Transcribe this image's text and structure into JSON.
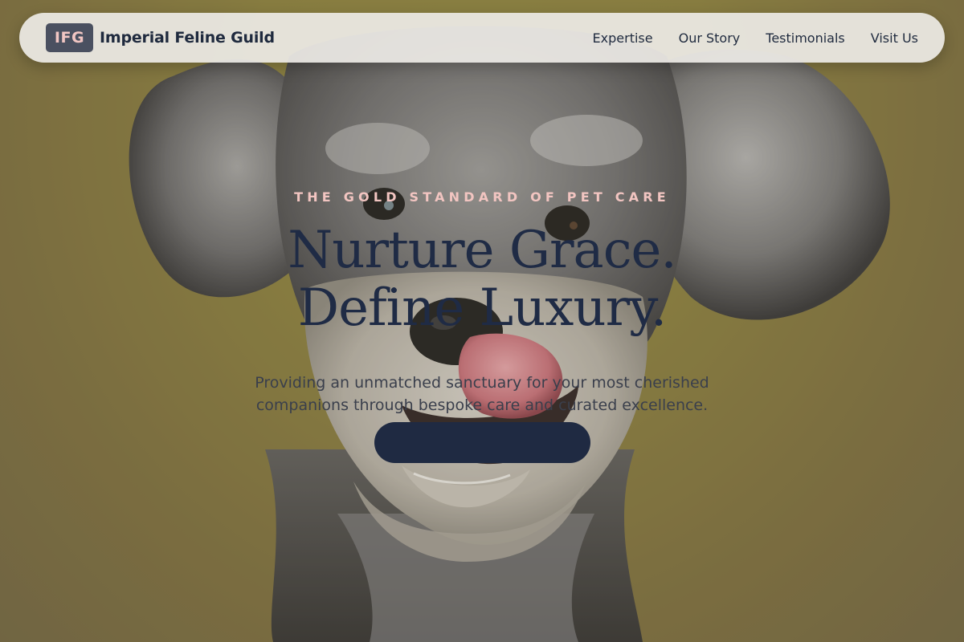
{
  "navbar": {
    "badge": "IFG",
    "brand_name": "Imperial Feline Guild",
    "links": [
      "Expertise",
      "Our Story",
      "Testimonials",
      "Visit Us"
    ]
  },
  "hero": {
    "eyebrow": "THE GOLD STANDARD OF PET CARE",
    "headline_line1": "Nurture Grace.",
    "headline_line2": "Define Luxury.",
    "subtitle": "Providing an unmatched sanctuary for your most cherished companions through bespoke care and curated excellence.",
    "cta_label": ""
  },
  "colors": {
    "background_olive": "#8a7f3e",
    "navbar_bg": "#eceae5",
    "badge_bg": "#4a5060",
    "badge_text": "#f1c6c3",
    "headline": "#1f2b45",
    "eyebrow": "#f2c5c1",
    "cta_bg": "#1f2a42"
  }
}
